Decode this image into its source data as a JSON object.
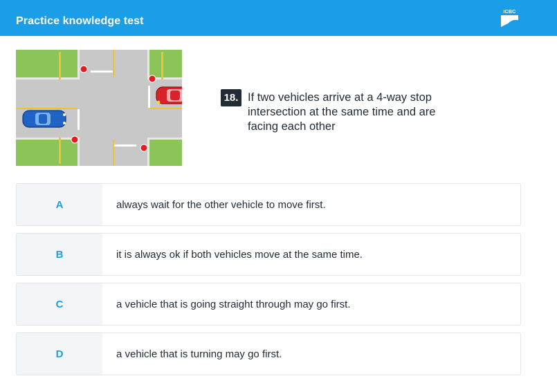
{
  "header": {
    "title": "Practice knowledge test",
    "logo_text": "ICBC",
    "background": "#1a9ee8"
  },
  "question": {
    "number": "18.",
    "text": "If two vehicles arrive at a 4-way stop intersection at the same time and are facing each other",
    "image_icon": "intersection-illustration"
  },
  "answers": [
    {
      "letter": "A",
      "text": "always wait for the other vehicle to move first."
    },
    {
      "letter": "B",
      "text": "it is always ok if both vehicles move at the same time."
    },
    {
      "letter": "C",
      "text": "a vehicle that is going straight through may go first."
    },
    {
      "letter": "D",
      "text": "a vehicle that is turning may go first."
    }
  ],
  "colors": {
    "accent": "#1a9ee8",
    "road": "#c8c8c8",
    "grass": "#8cc45a",
    "stop_sign": "#e31b23",
    "car_blue": "#1f63c6",
    "car_red": "#d9232a"
  }
}
